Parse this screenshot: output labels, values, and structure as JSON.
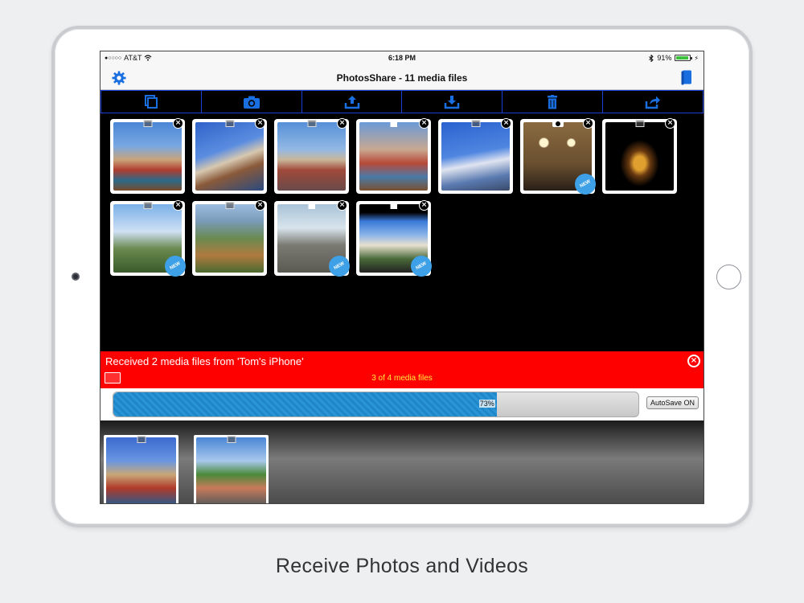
{
  "status_bar": {
    "carrier": "AT&T",
    "time": "6:18 PM",
    "battery_percent": "91%",
    "battery_level": 0.91
  },
  "nav": {
    "title": "PhotosShare - 11 media files",
    "left_icon": "gear-icon",
    "right_icon": "book-icon"
  },
  "toolbar": {
    "buttons": [
      "copy-icon",
      "camera-icon",
      "upload-icon",
      "download-icon",
      "trash-icon",
      "share-icon"
    ],
    "accent_color": "#1a3fd8"
  },
  "media_grid": {
    "items": [
      {
        "type": "photo",
        "is_new": false
      },
      {
        "type": "photo",
        "is_new": false
      },
      {
        "type": "photo",
        "is_new": false
      },
      {
        "type": "video",
        "is_new": false
      },
      {
        "type": "photo",
        "is_new": false
      },
      {
        "type": "camera",
        "is_new": true,
        "badge": "NEW"
      },
      {
        "type": "photo",
        "is_new": false
      },
      {
        "type": "photo",
        "is_new": true,
        "badge": "NEW"
      },
      {
        "type": "photo",
        "is_new": false
      },
      {
        "type": "video",
        "is_new": true,
        "badge": "NEW"
      },
      {
        "type": "video",
        "is_new": true,
        "badge": "NEW"
      }
    ]
  },
  "transfer": {
    "headline": "Received 2 media files from 'Tom's iPhone'",
    "file_count": "3 of 4 media files",
    "progress_label": "73%",
    "progress": 0.73,
    "autosave_label": "AutoSave ON",
    "banner_color": "#ff0000"
  },
  "caption": "Receive Photos and Videos"
}
